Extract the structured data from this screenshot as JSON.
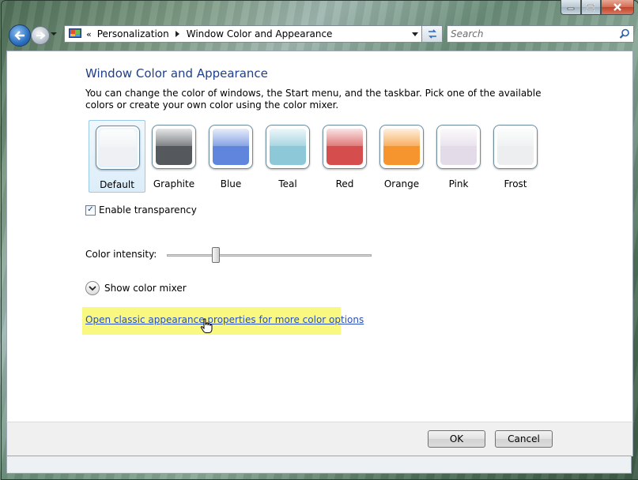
{
  "address_bar": {
    "overflow_chevron": "«",
    "crumbs": [
      "Personalization",
      "Window Color and Appearance"
    ]
  },
  "search": {
    "placeholder": "Search"
  },
  "page": {
    "title": "Window Color and Appearance",
    "description": "You can change the color of windows, the Start menu, and the taskbar. Pick one of the available colors or create your own color using the color mixer."
  },
  "swatches": [
    {
      "label": "Default",
      "color": "#eef0f4",
      "selected": true
    },
    {
      "label": "Graphite",
      "color": "#55585c",
      "selected": false
    },
    {
      "label": "Blue",
      "color": "#5f86dc",
      "selected": false
    },
    {
      "label": "Teal",
      "color": "#8cc8d8",
      "selected": false
    },
    {
      "label": "Red",
      "color": "#d64d4d",
      "selected": false
    },
    {
      "label": "Orange",
      "color": "#f6952d",
      "selected": false
    },
    {
      "label": "Pink",
      "color": "#e4dbe8",
      "selected": false
    },
    {
      "label": "Frost",
      "color": "#eceeef",
      "selected": false
    }
  ],
  "transparency": {
    "label": "Enable transparency",
    "checked": true
  },
  "intensity": {
    "label": "Color intensity:",
    "value": 0.23
  },
  "mixer": {
    "label": "Show color mixer"
  },
  "classic_link": {
    "label": "Open classic appearance properties for more color options",
    "highlight_color": "#f9f981"
  },
  "buttons": {
    "ok": "OK",
    "cancel": "Cancel"
  },
  "icons": [
    "back-arrow-icon",
    "forward-arrow-icon",
    "control-panel-icon",
    "refresh-icon",
    "search-icon",
    "expand-chevron-icon",
    "hand-cursor-icon",
    "minimize-icon",
    "maximize-icon",
    "close-icon"
  ]
}
